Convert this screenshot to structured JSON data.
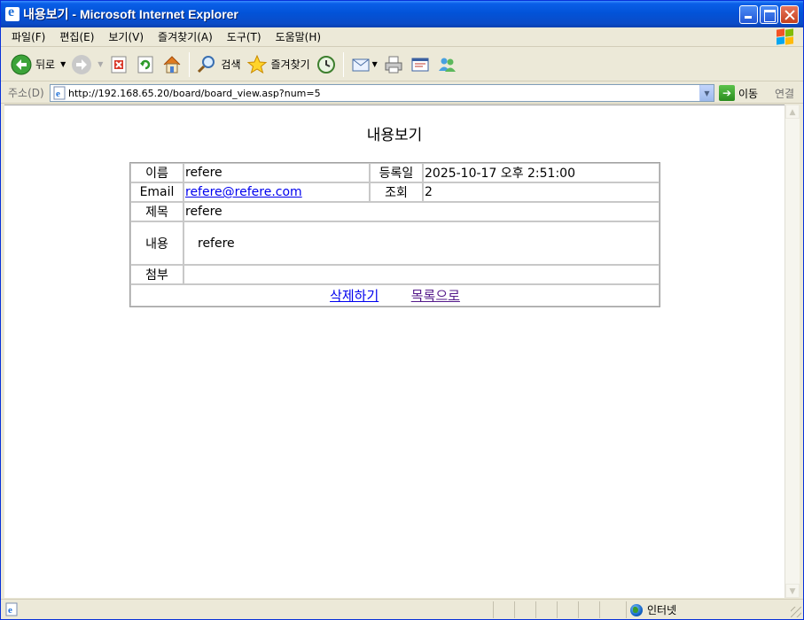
{
  "window": {
    "title": "내용보기 - Microsoft Internet Explorer"
  },
  "menu": {
    "items": [
      "파일(F)",
      "편집(E)",
      "보기(V)",
      "즐겨찾기(A)",
      "도구(T)",
      "도움말(H)"
    ]
  },
  "toolbar": {
    "back_label": "뒤로",
    "search_label": "검색",
    "favorites_label": "즐겨찾기"
  },
  "address": {
    "label": "주소(D)",
    "url": "http://192.168.65.20/board/board_view.asp?num=5",
    "go_label": "이동",
    "links_label": "연결"
  },
  "page": {
    "title": "내용보기",
    "fields": {
      "name_label": "이름",
      "name_value": "refere",
      "date_label": "등록일",
      "date_value": "2025-10-17 오후 2:51:00",
      "email_label": "Email",
      "email_value": "refere@refere.com",
      "views_label": "조회",
      "views_value": "2",
      "subject_label": "제목",
      "subject_value": "refere",
      "content_label": "내용",
      "content_value": "refere",
      "attach_label": "첨부",
      "attach_value": ""
    },
    "actions": {
      "delete_label": "삭제하기",
      "list_label": "목록으로"
    }
  },
  "statusbar": {
    "zone_label": "인터넷"
  },
  "colors": {
    "titlebar": "#0253D8",
    "link": "#0000EE",
    "visited_link": "#551A8B"
  }
}
